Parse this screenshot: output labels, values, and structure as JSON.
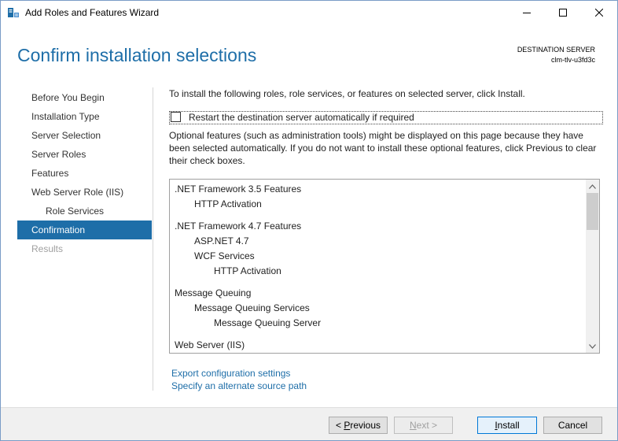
{
  "window": {
    "title": "Add Roles and Features Wizard",
    "icon": "server-manager-icon",
    "controls": {
      "minimize": "minimize-icon",
      "maximize": "maximize-icon",
      "close": "close-icon"
    }
  },
  "header": {
    "title": "Confirm installation selections",
    "destination_label": "DESTINATION SERVER",
    "destination_name": "clm-tlv-u3fd3c"
  },
  "nav": {
    "items": [
      {
        "label": "Before You Begin",
        "state": "normal"
      },
      {
        "label": "Installation Type",
        "state": "normal"
      },
      {
        "label": "Server Selection",
        "state": "normal"
      },
      {
        "label": "Server Roles",
        "state": "normal"
      },
      {
        "label": "Features",
        "state": "normal"
      },
      {
        "label": "Web Server Role (IIS)",
        "state": "normal"
      },
      {
        "label": "Role Services",
        "state": "sub"
      },
      {
        "label": "Confirmation",
        "state": "active"
      },
      {
        "label": "Results",
        "state": "disabled"
      }
    ]
  },
  "content": {
    "intro": "To install the following roles, role services, or features on selected server, click Install.",
    "restart_label": "Restart the destination server automatically if required",
    "restart_checked": false,
    "optional_text": "Optional features (such as administration tools) might be displayed on this page because they have been selected automatically. If you do not want to install these optional features, click Previous to clear their check boxes.",
    "features": [
      {
        "text": ".NET Framework 3.5 Features",
        "level": 0
      },
      {
        "text": "HTTP Activation",
        "level": 1
      },
      {
        "text": ".NET Framework 4.7 Features",
        "level": 0
      },
      {
        "text": "ASP.NET 4.7",
        "level": 1
      },
      {
        "text": "WCF Services",
        "level": 1
      },
      {
        "text": "HTTP Activation",
        "level": 2
      },
      {
        "text": "Message Queuing",
        "level": 0
      },
      {
        "text": "Message Queuing Services",
        "level": 1
      },
      {
        "text": "Message Queuing Server",
        "level": 2
      },
      {
        "text": "Web Server (IIS)",
        "level": 0
      }
    ],
    "links": {
      "export": "Export configuration settings",
      "alternate_source": "Specify an alternate source path"
    }
  },
  "footer": {
    "previous": {
      "prefix": "< ",
      "accel": "P",
      "rest": "revious"
    },
    "next": {
      "accel": "N",
      "rest": "ext >"
    },
    "install": {
      "accel": "I",
      "rest": "nstall"
    },
    "cancel": "Cancel"
  },
  "colors": {
    "accent": "#1e6ea8",
    "nav_active_bg": "#1e6ea8",
    "footer_bg": "#f0f0f0"
  }
}
